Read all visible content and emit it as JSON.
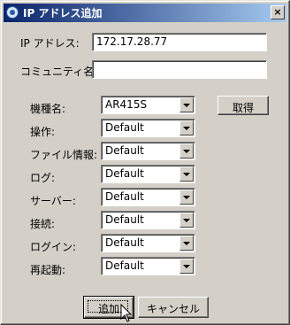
{
  "window": {
    "title": "IP アドレス追加",
    "close_label": "×"
  },
  "fields": {
    "ip_label": "IP アドレス:",
    "ip_value": "172.17.28.77",
    "community_label": "コミュニティ名:",
    "community_value": ""
  },
  "combos": [
    {
      "label": "機種名:",
      "value": "AR415S"
    },
    {
      "label": "操作:",
      "value": "Default"
    },
    {
      "label": "ファイル情報:",
      "value": "Default"
    },
    {
      "label": "ログ:",
      "value": "Default"
    },
    {
      "label": "サーバー:",
      "value": "Default"
    },
    {
      "label": "接続:",
      "value": "Default"
    },
    {
      "label": "ログイン:",
      "value": "Default"
    },
    {
      "label": "再起動:",
      "value": "Default"
    }
  ],
  "buttons": {
    "fetch": "取得",
    "add": "追加",
    "cancel": "キャンセル"
  },
  "icons": {
    "title_icon": "app-globe-icon",
    "cursor": "mouse-pointer-icon"
  }
}
